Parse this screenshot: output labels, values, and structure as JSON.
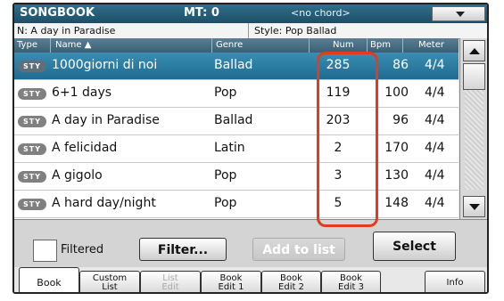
{
  "header": {
    "title": "SONGBOOK",
    "mt": "MT: 0",
    "chord": "<no chord>"
  },
  "info": {
    "song": "N: A day in Paradise",
    "style": "Style: Pop Ballad"
  },
  "columns": {
    "type": "Type",
    "name": "Name",
    "sort_arrow": "▲",
    "genre": "Genre",
    "num": "Num",
    "bpm": "Bpm",
    "meter": "Meter"
  },
  "rows": [
    {
      "badge": "STY",
      "name": "1000giorni di noi",
      "genre": "Ballad",
      "num": "285",
      "bpm": "86",
      "meter": "4/4",
      "selected": true
    },
    {
      "badge": "STY",
      "name": "6+1 days",
      "genre": "Pop",
      "num": "119",
      "bpm": "100",
      "meter": "4/4"
    },
    {
      "badge": "STY",
      "name": "A day in Paradise",
      "genre": "Ballad",
      "num": "203",
      "bpm": "96",
      "meter": "4/4"
    },
    {
      "badge": "STY",
      "name": "A felicidad",
      "genre": "Latin",
      "num": "2",
      "bpm": "170",
      "meter": "4/4"
    },
    {
      "badge": "STY",
      "name": "A gigolo",
      "genre": "Pop",
      "num": "3",
      "bpm": "130",
      "meter": "4/4"
    },
    {
      "badge": "STY",
      "name": "A hard day/night",
      "genre": "Pop",
      "num": "5",
      "bpm": "148",
      "meter": "4/4"
    }
  ],
  "controls": {
    "filtered_label": "Filtered",
    "filter_button": "Filter...",
    "add_button": "Add to list",
    "select_button": "Select"
  },
  "tabs": [
    {
      "line1": "Book",
      "line2": ""
    },
    {
      "line1": "Custom",
      "line2": "List"
    },
    {
      "line1": "List",
      "line2": "Edit"
    },
    {
      "line1": "Book",
      "line2": "Edit 1"
    },
    {
      "line1": "Book",
      "line2": "Edit 2"
    },
    {
      "line1": "Book",
      "line2": "Edit 3"
    },
    {
      "line1": "Info",
      "line2": ""
    }
  ],
  "colors": {
    "accent": "#1f6c91",
    "highlight": "#e53a1e",
    "header": "#2f6f8c"
  },
  "icons": {
    "menu": "chevron-down-icon",
    "scroll_up": "arrow-up-icon",
    "scroll_down": "arrow-down-icon"
  }
}
